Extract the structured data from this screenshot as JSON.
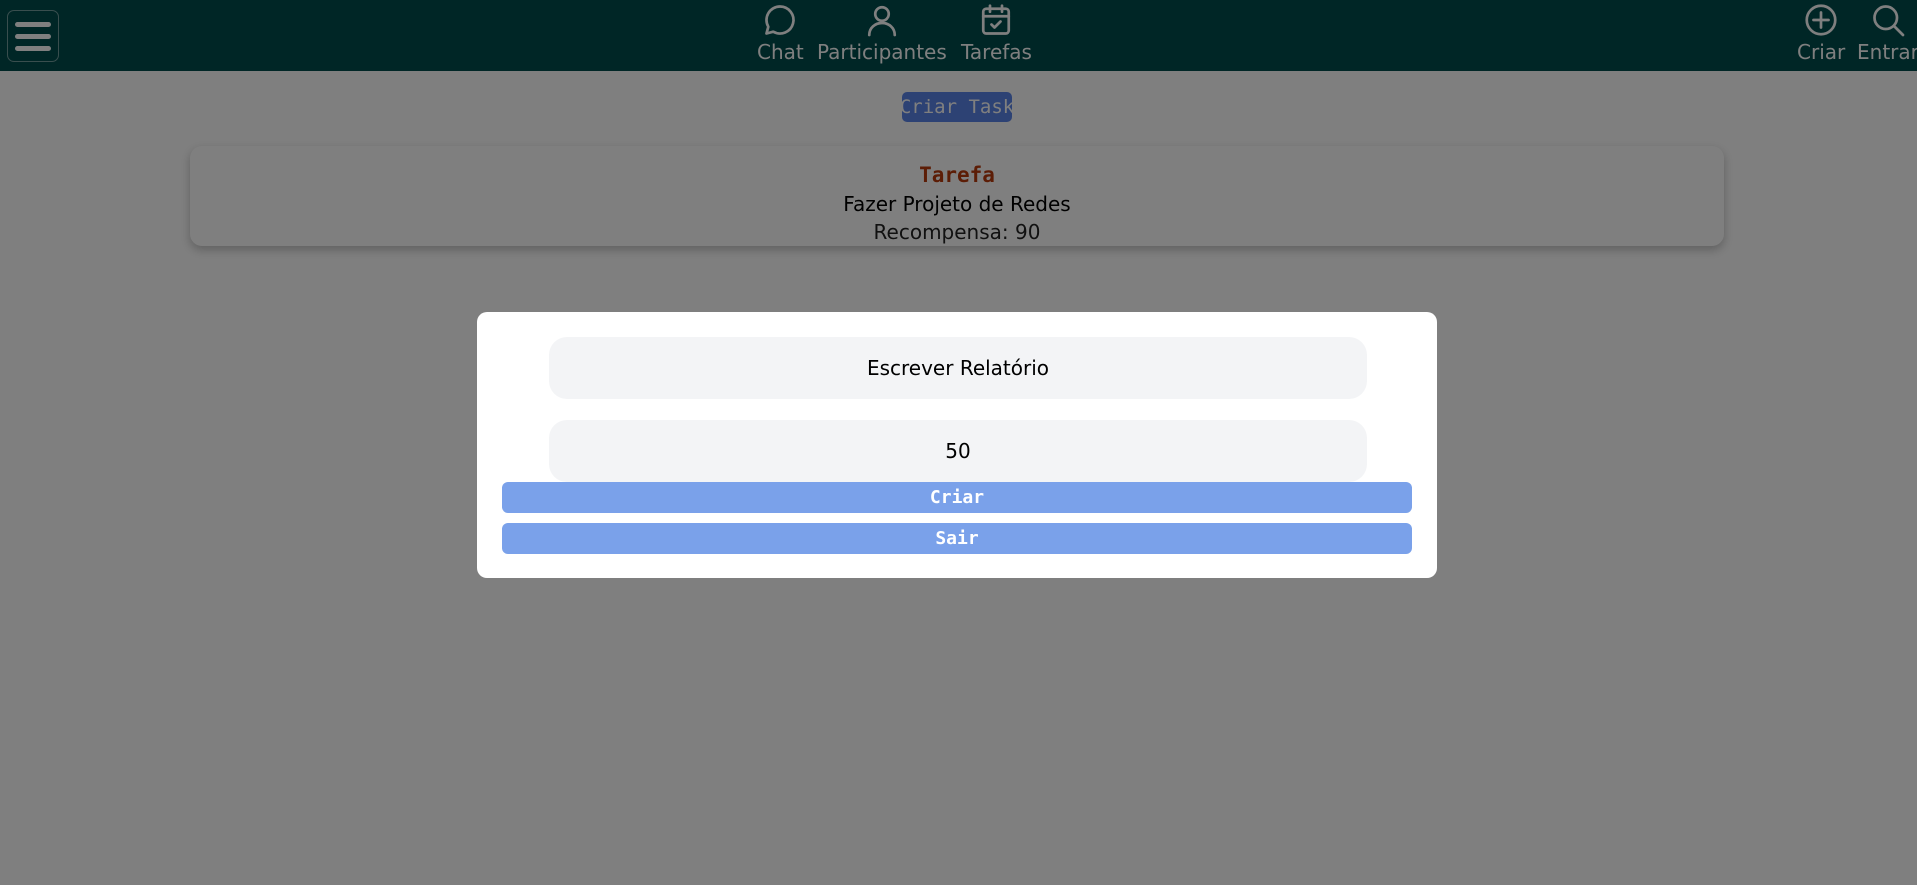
{
  "nav": {
    "chat_label": "Chat",
    "participantes_label": "Participantes",
    "tarefas_label": "Tarefas",
    "criar_label": "Criar",
    "entrar_label": "Entrar"
  },
  "main": {
    "criar_task_label": "Criar Task",
    "task_card": {
      "heading": "Tarefa",
      "name": "Fazer Projeto de Redes",
      "reward": "Recompensa: 90"
    }
  },
  "modal": {
    "title_value": "Escrever Relatório",
    "reward_value": "50",
    "criar_label": "Criar",
    "sair_label": "Sair"
  },
  "colors": {
    "topbar": "#004d4d",
    "button_blue": "#7aa1ea",
    "task_heading": "#b83a0d"
  },
  "icons": [
    "menu-icon",
    "chat-icon",
    "user-icon",
    "calendar-check-icon",
    "plus-circle-icon",
    "search-icon"
  ]
}
